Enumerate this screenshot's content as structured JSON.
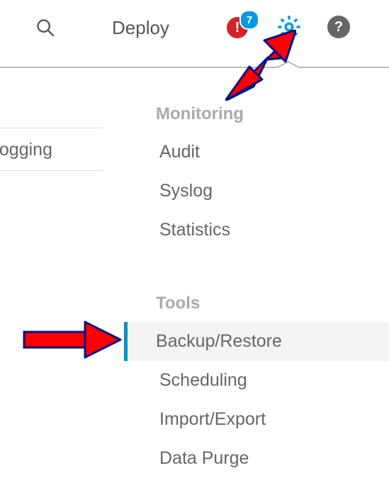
{
  "topbar": {
    "deploy_label": "Deploy",
    "warning_symbol": "!",
    "notification_count": "7",
    "help_symbol": "?"
  },
  "left": {
    "logging_label": "Logging"
  },
  "menu": {
    "section1_label": "Monitoring",
    "audit_label": "Audit",
    "syslog_label": "Syslog",
    "statistics_label": "Statistics",
    "section2_label": "Tools",
    "backup_label": "Backup/Restore",
    "scheduling_label": "Scheduling",
    "import_export_label": "Import/Export",
    "data_purge_label": "Data Purge"
  },
  "annotations": {
    "arrow_color": "#ff0000",
    "arrow_stroke": "#001489"
  }
}
